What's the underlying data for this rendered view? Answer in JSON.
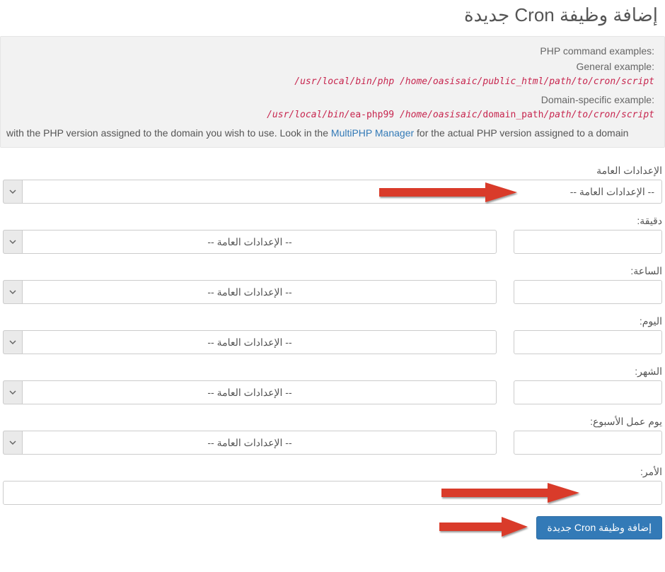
{
  "page_title": "إضافة وظيفة Cron جديدة",
  "info": {
    "php_examples_label": "PHP command examples:",
    "general_label": "General example:",
    "general_code": "/usr/local/bin/php /home/oasisaic/public_html/path/to/cron/script",
    "domain_label": "Domain-specific example:",
    "domain_code_prefix": "/usr/local/bin/",
    "domain_code_bin": "ea-php99",
    "domain_code_mid": " /home/oasisaic/",
    "domain_code_dpath": "domain_path",
    "domain_code_suffix": "/path/to/cron/script",
    "note_before": "with the PHP version assigned to the domain you wish to use. Look in the ",
    "note_link_text": "MultiPHP Manager",
    "note_after": " for the actual PHP version assigned to a domain"
  },
  "labels": {
    "common_settings": "الإعدادات العامة",
    "minute": "دقيقة:",
    "hour": "الساعة:",
    "day": "اليوم:",
    "month": "الشهر:",
    "weekday": "يوم عمل الأسبوع:",
    "command": "الأمر:"
  },
  "placeholders": {
    "common_settings_option": "-- الإعدادات العامة --"
  },
  "values": {
    "minute": "",
    "hour": "",
    "day": "",
    "month": "",
    "weekday": "",
    "command": ""
  },
  "submit_label": "إضافة وظيفة Cron جديدة"
}
